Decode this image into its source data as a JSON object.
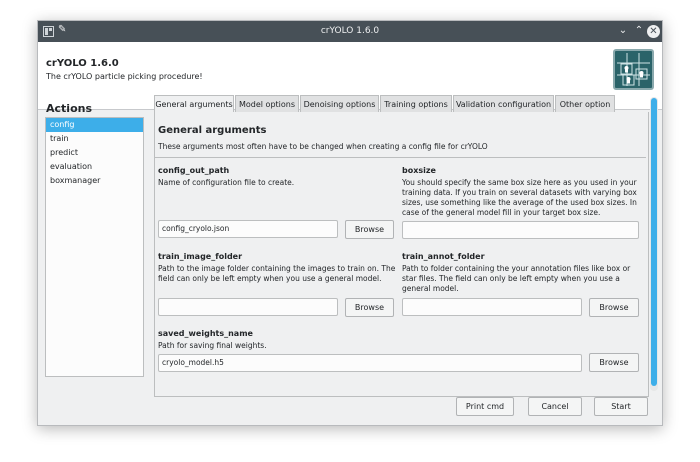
{
  "window": {
    "title": "crYOLO 1.6.0"
  },
  "header": {
    "app_name": "crYOLO 1.6.0",
    "app_description": "The crYOLO particle picking procedure!",
    "logo_icon": "cryolo-logo-icon"
  },
  "actions": {
    "title": "Actions",
    "items": [
      {
        "label": "config",
        "selected": true
      },
      {
        "label": "train",
        "selected": false
      },
      {
        "label": "predict",
        "selected": false
      },
      {
        "label": "evaluation",
        "selected": false
      },
      {
        "label": "boxmanager",
        "selected": false
      }
    ]
  },
  "tabs": [
    {
      "label": "General arguments",
      "active": true
    },
    {
      "label": "Model options",
      "active": false
    },
    {
      "label": "Denoising options",
      "active": false
    },
    {
      "label": "Training options",
      "active": false
    },
    {
      "label": "Validation configuration",
      "active": false
    },
    {
      "label": "Other option",
      "active": false
    }
  ],
  "section": {
    "title": "General arguments",
    "description": "These arguments most often have to be changed when creating a config file for crYOLO"
  },
  "fields": {
    "config_out_path": {
      "label": "config_out_path",
      "help": "Name of configuration file to create.",
      "value": "config_cryolo.json",
      "browse_label": "Browse"
    },
    "boxsize": {
      "label": "boxsize",
      "help_lines": [
        "You should specify the same box size here as you used in your",
        "training data.  If you train on several datasets with varying box",
        "sizes, use something like the average of the used box sizes. In",
        "case of the general model fill in your target box size."
      ],
      "value": ""
    },
    "train_image_folder": {
      "label": "train_image_folder",
      "help_lines": [
        "Path to the image folder containing the images to train on. The",
        "field can only be left empty when you use a general model."
      ],
      "value": "",
      "browse_label": "Browse"
    },
    "train_annot_folder": {
      "label": "train_annot_folder",
      "help_lines": [
        "Path to folder containing the your annotation files like box or",
        "star files. The field can only be left empty when you use a",
        "general model."
      ],
      "value": "",
      "browse_label": "Browse"
    },
    "saved_weights_name": {
      "label": "saved_weights_name",
      "help": "Path for saving final weights.",
      "value": "cryolo_model.h5",
      "browse_label": "Browse"
    }
  },
  "buttons": {
    "print_cmd": "Print cmd",
    "cancel": "Cancel",
    "start": "Start"
  },
  "colors": {
    "accent": "#3daee9",
    "titlebar": "#475057",
    "background": "#eff0f1",
    "logo": "#2a6369"
  }
}
